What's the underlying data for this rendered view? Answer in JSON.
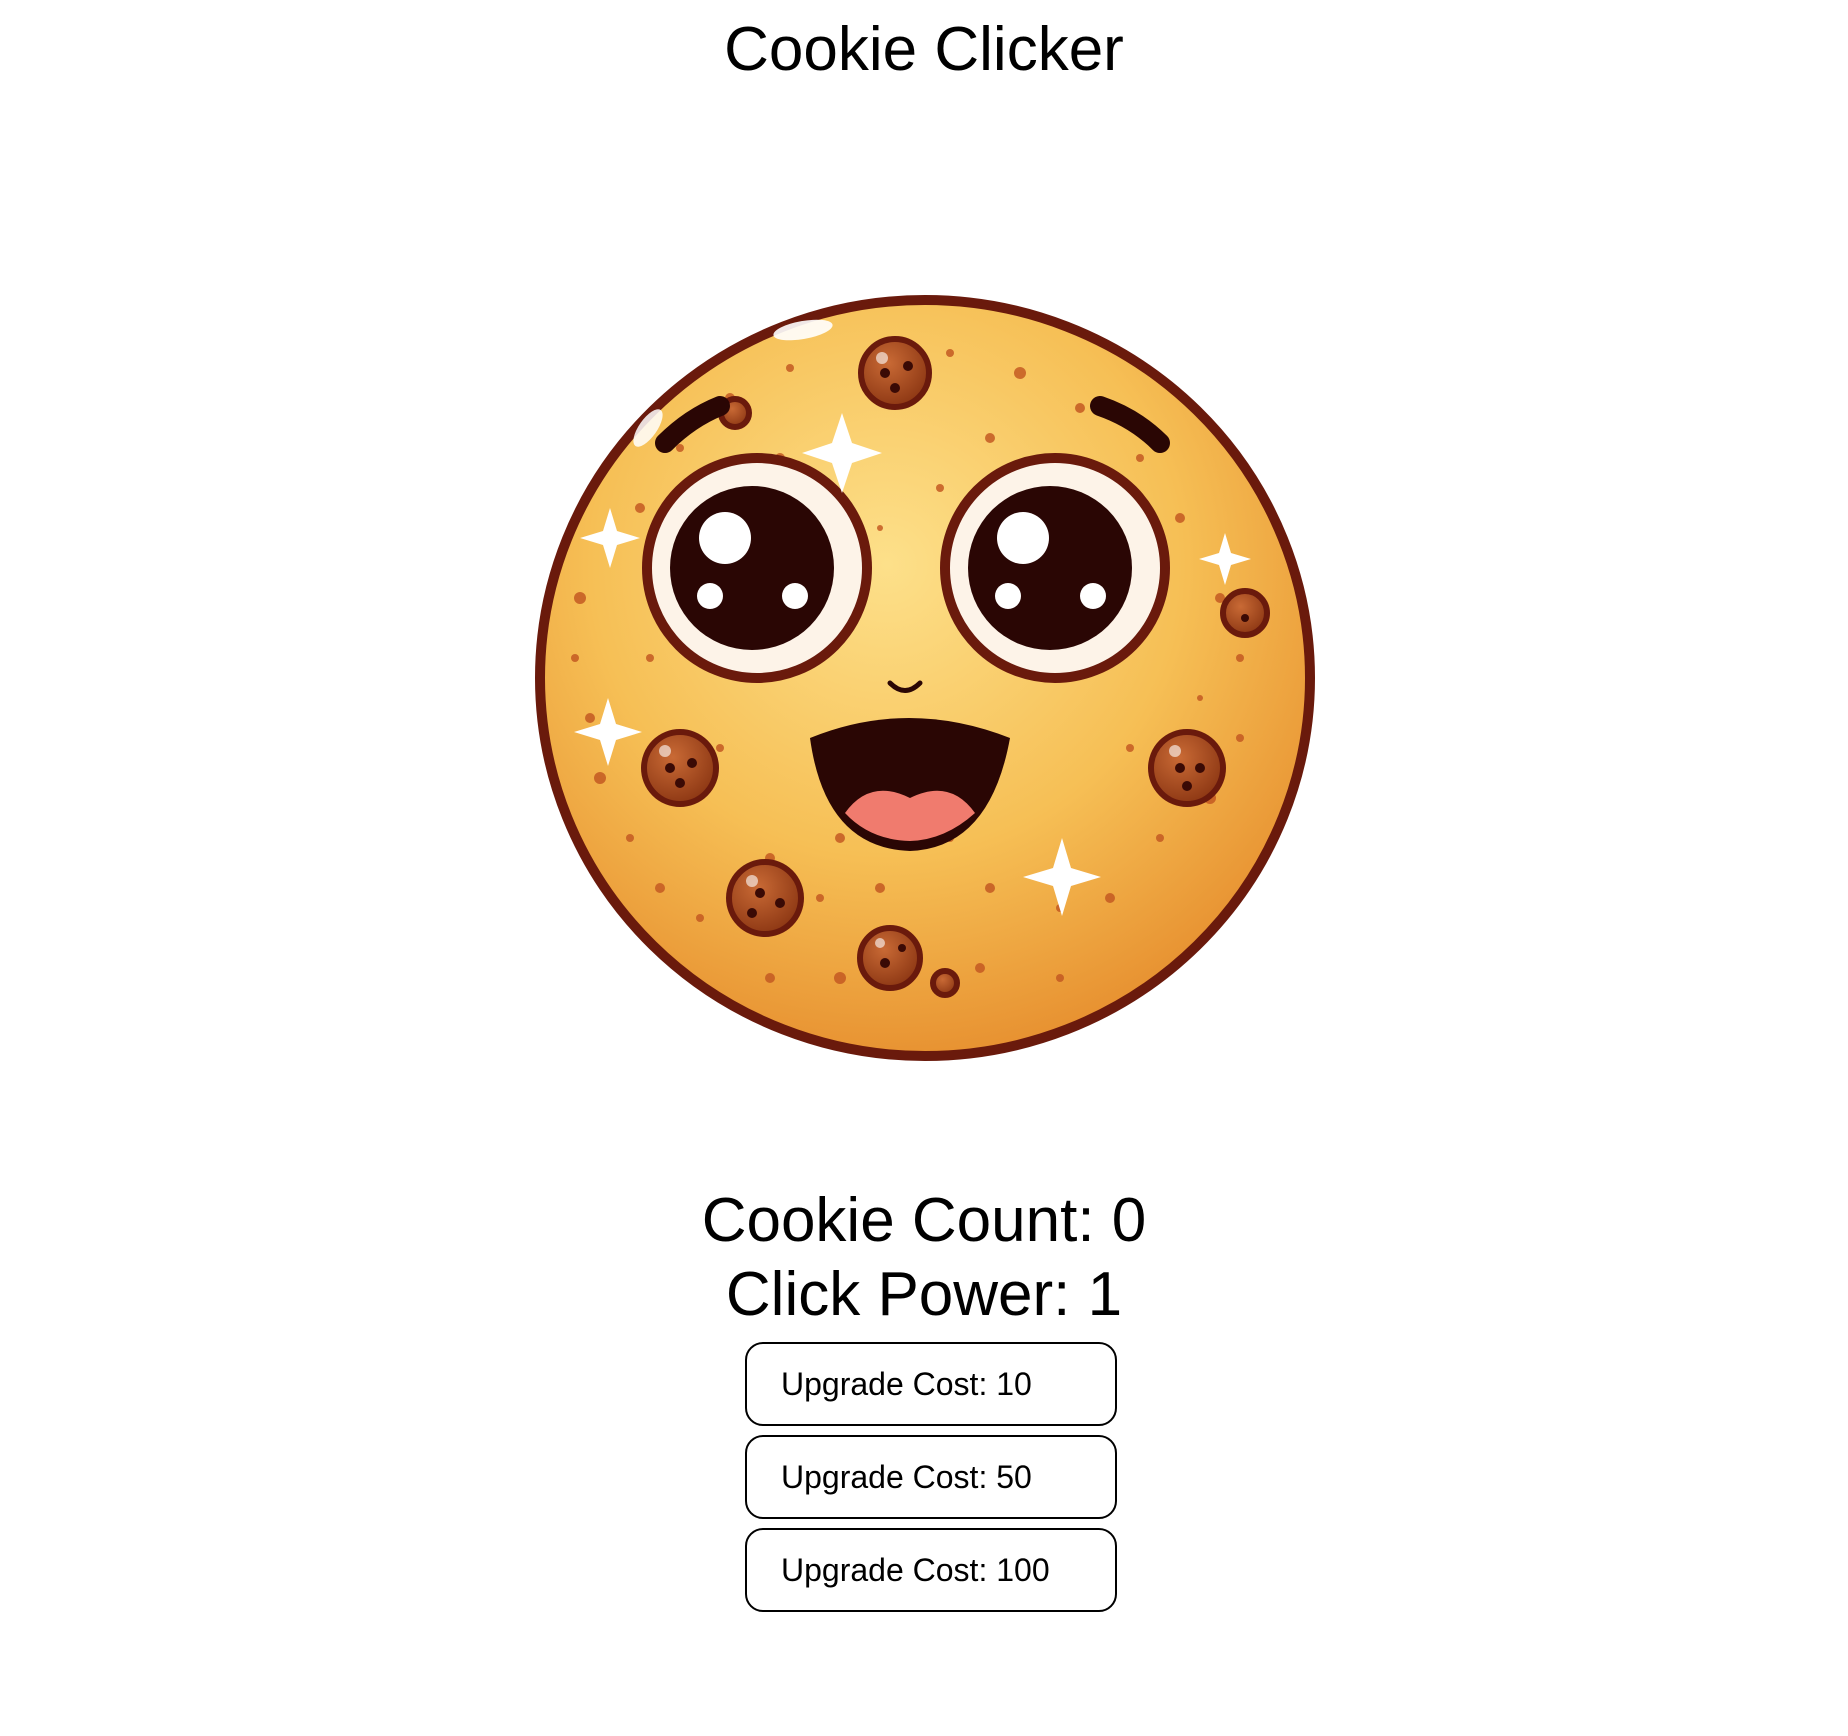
{
  "header": {
    "title": "Cookie Clicker"
  },
  "cookie": {
    "icon": "smiling-cookie-icon",
    "colors": {
      "dough": "#f4b547",
      "dough_light": "#fbd576",
      "outline": "#6a1a0c",
      "chip": "#a0491e",
      "eye": "#2a0604",
      "mouth": "#2a0604",
      "tongue": "#f07b6e",
      "sparkle": "#ffffff"
    }
  },
  "stats": {
    "cookie_count_label": "Cookie Count: 0",
    "click_power_label": "Click Power: 1"
  },
  "upgrades": [
    {
      "label": "Upgrade Cost: 10"
    },
    {
      "label": "Upgrade Cost: 50"
    },
    {
      "label": "Upgrade Cost: 100"
    }
  ]
}
